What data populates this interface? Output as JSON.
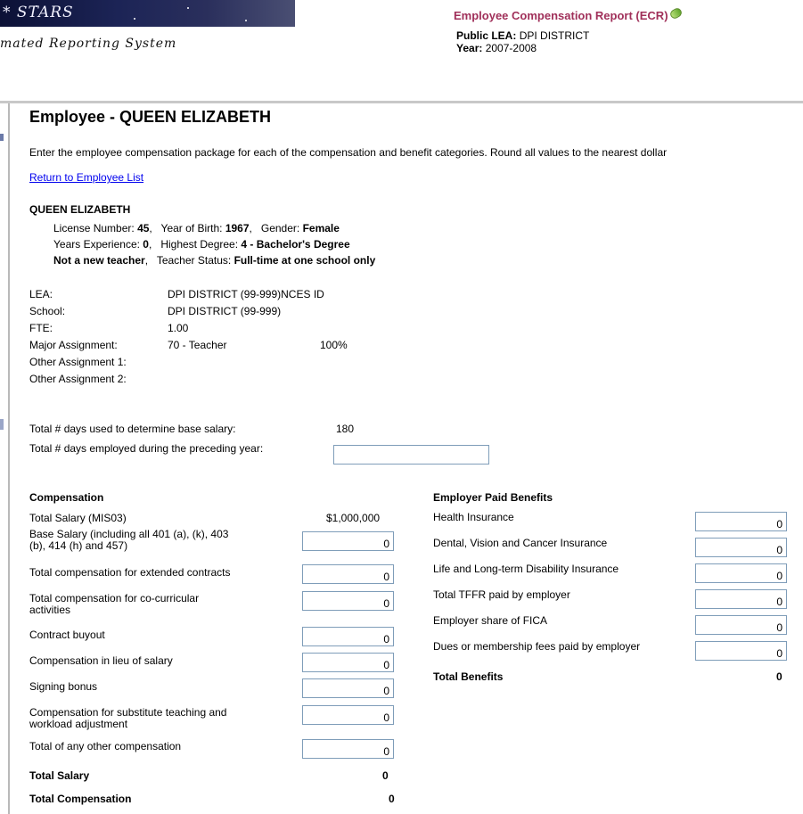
{
  "header": {
    "banner_title": "STARS",
    "subtitle": "mated Reporting System",
    "report_title": "Employee Compensation Report (ECR)",
    "lea_label": "Public LEA:",
    "lea_value": "DPI DISTRICT",
    "year_label": "Year:",
    "year_value": "2007-2008"
  },
  "page": {
    "title": "Employee - QUEEN ELIZABETH",
    "instructions": "Enter the employee compensation package for each of the compensation and benefit categories. Round all values to the nearest dollar",
    "return_link": "Return to Employee List"
  },
  "employee": {
    "name": "QUEEN ELIZABETH",
    "license_label": "License Number:",
    "license_value": "45",
    "yob_label": "Year of Birth:",
    "yob_value": "1967",
    "gender_label": "Gender:",
    "gender_value": "Female",
    "experience_label": "Years Experience:",
    "experience_value": "0",
    "degree_label": "Highest Degree:",
    "degree_value": "4 - Bachelor's Degree",
    "new_teacher": "Not a new teacher",
    "status_label": "Teacher Status:",
    "status_value": "Full-time at one school only"
  },
  "details": {
    "lea_label": "LEA:",
    "lea_value": "DPI DISTRICT (99-999)NCES ID",
    "school_label": "School:",
    "school_value": "DPI DISTRICT (99-999)",
    "fte_label": "FTE:",
    "fte_value": "1.00",
    "major_label": "Major Assignment:",
    "major_value": "70 - Teacher",
    "major_pct": "100%",
    "other1_label": "Other Assignment 1:",
    "other2_label": "Other Assignment 2:"
  },
  "days": {
    "base_label": "Total # days used to determine base salary:",
    "base_value": "180",
    "preceding_label": "Total # days employed during the preceding year:",
    "preceding_value": ""
  },
  "compensation": {
    "title": "Compensation",
    "total_salary_mis_label": "Total Salary (MIS03)",
    "total_salary_mis_value": "$1,000,000",
    "base_l1": "Base Salary (including all 401 (a), (k), 403",
    "base_l2": "(b), 414 (h) and 457)",
    "base_value": "0",
    "extended_label": "Total compensation for extended contracts",
    "extended_value": "0",
    "cocurr_l1": "Total compensation for co-curricular",
    "cocurr_l2": "activities",
    "cocurr_value": "0",
    "buyout_label": "Contract buyout",
    "buyout_value": "0",
    "lieu_label": "Compensation in lieu of salary",
    "lieu_value": "0",
    "signing_label": "Signing bonus",
    "signing_value": "0",
    "subst_l1": "Compensation for substitute teaching and",
    "subst_l2": "workload adjustment",
    "subst_value": "0",
    "other_label": "Total of any other compensation",
    "other_value": "0",
    "total_salary_label": "Total Salary",
    "total_salary_value": "0",
    "total_comp_label": "Total Compensation",
    "total_comp_value": "0"
  },
  "benefits": {
    "title": "Employer Paid Benefits",
    "health_label": "Health Insurance",
    "health_value": "0",
    "dental_label": "Dental, Vision and Cancer Insurance",
    "dental_value": "0",
    "life_label": "Life and Long-term Disability Insurance",
    "life_value": "0",
    "tffr_label": "Total TFFR paid by employer",
    "tffr_value": "0",
    "fica_label": "Employer share of FICA",
    "fica_value": "0",
    "dues_label": "Dues or membership fees paid by employer",
    "dues_value": "0",
    "total_label": "Total Benefits",
    "total_value": "0"
  }
}
